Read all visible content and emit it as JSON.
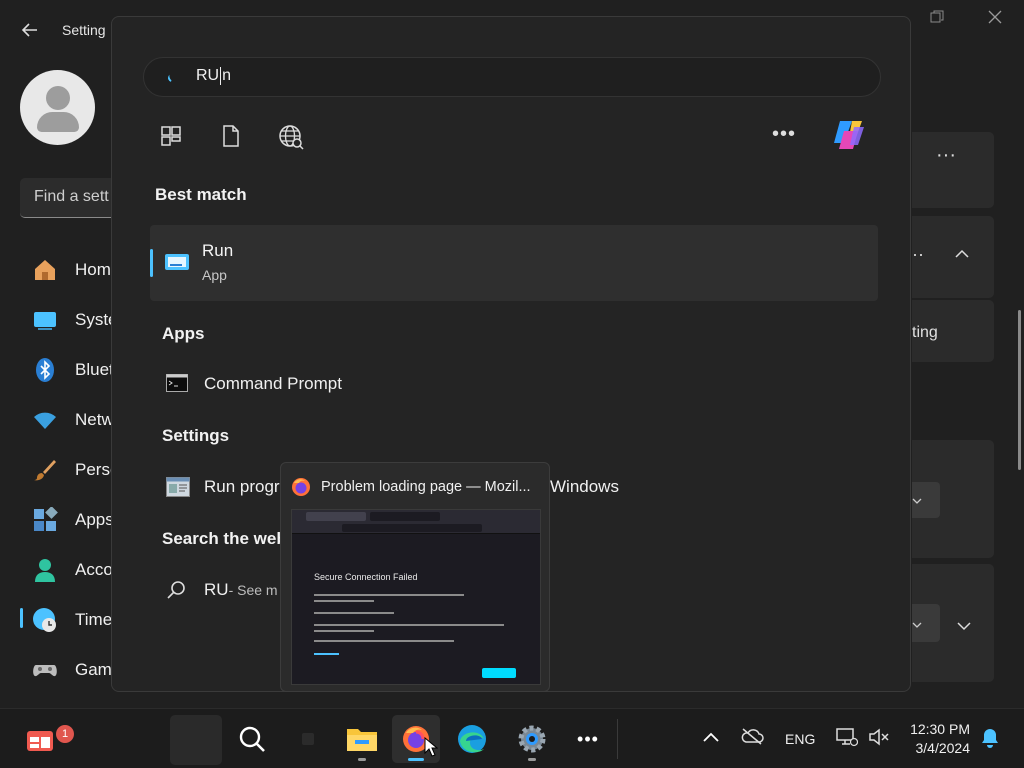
{
  "settings": {
    "title": "Setting",
    "find_placeholder": "Find a sett",
    "nav": [
      {
        "label": "Hom",
        "icon": "home-icon",
        "color": "#e8a15c"
      },
      {
        "label": "Syste",
        "icon": "system-icon",
        "color": "#4cc2ff"
      },
      {
        "label": "Bluet",
        "icon": "bluetooth-icon",
        "color": "#2a7fd4"
      },
      {
        "label": "Netw",
        "icon": "network-icon",
        "color": "#3aa0e0"
      },
      {
        "label": "Perso",
        "icon": "personalization-icon",
        "color": "#e0a060"
      },
      {
        "label": "Apps",
        "icon": "apps-icon",
        "color": "#6aa9e0"
      },
      {
        "label": "Acco",
        "icon": "accounts-icon",
        "color": "#2fc4a0"
      },
      {
        "label": "Time",
        "icon": "time-language-icon",
        "color": "#4cc2ff"
      },
      {
        "label": "Gam",
        "icon": "gaming-icon",
        "color": "#bdbdbd"
      }
    ],
    "right_partial_text": "ting"
  },
  "search": {
    "query_before_caret": "RU",
    "query_after_caret": "n",
    "best_match_heading": "Best match",
    "best_match": {
      "title": "Run",
      "subtitle": "App"
    },
    "apps_heading": "Apps",
    "apps": [
      {
        "label": "Command Prompt"
      }
    ],
    "settings_heading": "Settings",
    "settings_results": [
      {
        "label_start": "Run progr",
        "label_end": "Windows"
      }
    ],
    "web_heading": "Search the web",
    "web_results": [
      {
        "label": "RU",
        "sub": " - See m"
      }
    ]
  },
  "preview": {
    "title": "Problem loading page — Mozil...",
    "page_heading": "Secure Connection Failed"
  },
  "taskbar": {
    "notification_badge": "1",
    "language": "ENG",
    "time": "12:30 PM",
    "date": "3/4/2024"
  },
  "colors": {
    "accent": "#4cc2ff",
    "badge": "#e0564e"
  }
}
